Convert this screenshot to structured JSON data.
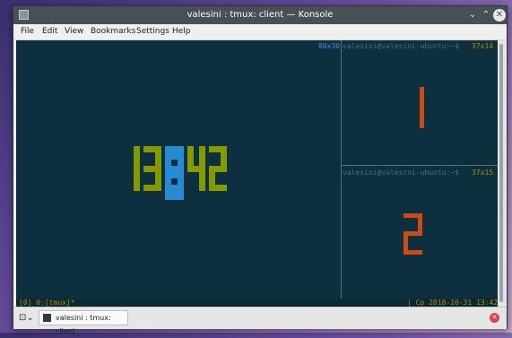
{
  "window": {
    "title": "valesini : tmux: client — Konsole",
    "minimize_glyph": "⌄",
    "maximize_glyph": "⌃",
    "close_glyph": "✕"
  },
  "menu": {
    "items": [
      "File",
      "Edit",
      "View",
      "Bookmarks",
      "Settings",
      "Help"
    ]
  },
  "terminal": {
    "left_pane_size": "80x30",
    "top_right_prompt": "valesini@valesini-ubuntu:~$",
    "top_right_size": "37x14",
    "bottom_right_prompt": "valesini@valesini-ubuntu:~$",
    "bottom_right_size": "37x15",
    "clock": "13:42",
    "status_left": "[0] 0:[tmux]*",
    "status_right": "| Cp 2018-10-31 13:42"
  },
  "tabbar": {
    "new_tab_glyph": "⊡⌄",
    "tab_label": "valesini : tmux: client",
    "close_glyph": "✕"
  },
  "colors": {
    "terminal_bg": "#0d2f3e",
    "clock_digits": "#859900",
    "clock_colon": "#268bd2",
    "pane_number": "#cb4b16",
    "status_text": "#b58900"
  },
  "icons": [
    "konsole-icon",
    "new-tab-icon",
    "terminal-tab-icon",
    "close-icon"
  ]
}
